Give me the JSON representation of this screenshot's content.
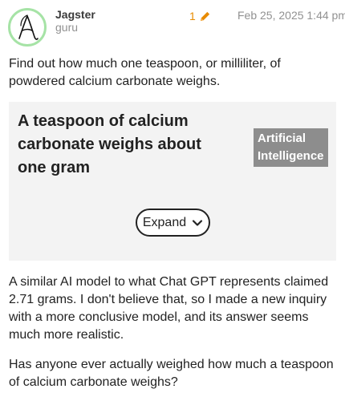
{
  "post": {
    "author": {
      "username": "Jagster",
      "title": "guru",
      "avatar_icon": "atheism-a-icon",
      "avatar_ring_color": "#a6e3a6"
    },
    "edit_count": "1",
    "edit_icon": "pencil-icon",
    "date": "Feb 25, 2025 1:44 pm",
    "paragraph_1": "Find out how much one teaspoon, or milliliter, of powdered calcium carbonate weighs.",
    "ai_summary": {
      "title": "A teaspoon of calcium carbonate weighs about one gram",
      "tag": "Artificial Intelligence",
      "expand_label": "Expand",
      "expand_icon": "chevron-down-icon",
      "background": "#f3f3f3",
      "tag_background": "#8d8d8d"
    },
    "paragraph_2": "A similar AI model to what Chat GPT represents claimed 2.71 grams. I don't believe that, so I made a new inquiry with a more conclusive model, and its answer seems much more realistic.",
    "paragraph_3": "Has anyone ever actually weighed how much a teaspoon of calcium carbonate weighs?"
  },
  "colors": {
    "edit_accent": "#e88b00",
    "muted_text": "#919191",
    "body_text": "#222222"
  }
}
